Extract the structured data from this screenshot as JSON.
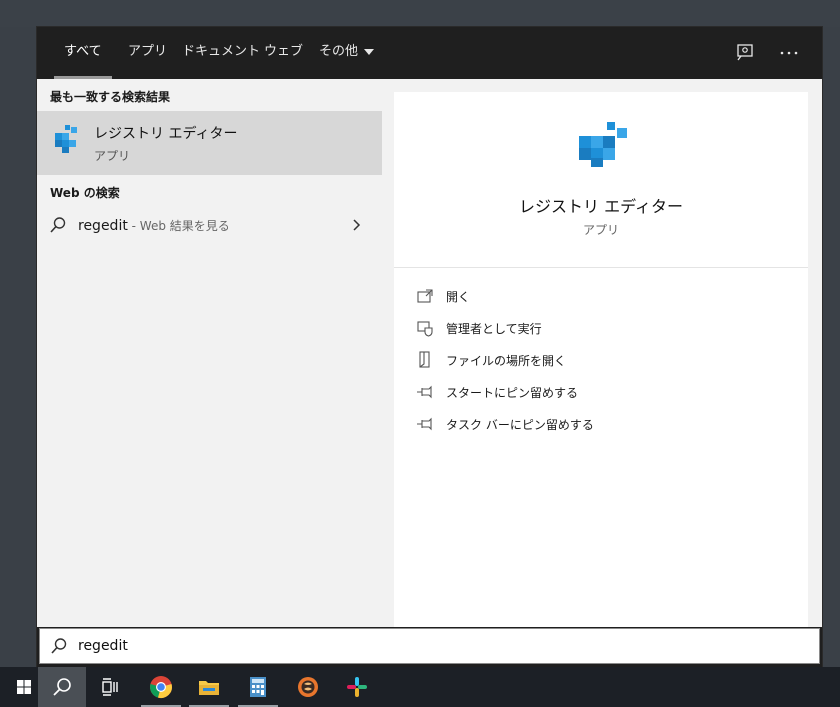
{
  "tabs": [
    {
      "label": "すべて",
      "active": true
    },
    {
      "label": "アプリ"
    },
    {
      "label": "ドキュメント"
    },
    {
      "label": "ウェブ"
    },
    {
      "label": "その他"
    }
  ],
  "top_icons": [
    "feedback-icon",
    "more-options-icon"
  ],
  "left": {
    "best_match_title": "最も一致する検索結果",
    "best_match": {
      "name": "レジストリ エディター",
      "type": "アプリ"
    },
    "web_title": "Web の検索",
    "web_result": {
      "query": "regedit",
      "suffix": " - Web 結果を見る"
    }
  },
  "preview": {
    "name": "レジストリ エディター",
    "type": "アプリ",
    "actions": [
      {
        "label": "開く",
        "icon": "open-icon"
      },
      {
        "label": "管理者として実行",
        "icon": "run-as-admin-icon"
      },
      {
        "label": "ファイルの場所を開く",
        "icon": "file-location-icon"
      },
      {
        "label": "スタートにピン留めする",
        "icon": "pin-icon"
      },
      {
        "label": "タスク バーにピン留めする",
        "icon": "pin-icon"
      }
    ]
  },
  "search": {
    "value": "regedit"
  },
  "colors": {
    "accent_blue": "#1e90d8",
    "selected_bg": "#d7d7d7",
    "panel_dark": "#1f1f1f"
  },
  "taskbar": [
    "start-icon",
    "search-icon",
    "task-view-icon",
    "chrome-icon",
    "file-explorer-icon",
    "calculator-icon",
    "app-icon",
    "slack-icon"
  ]
}
